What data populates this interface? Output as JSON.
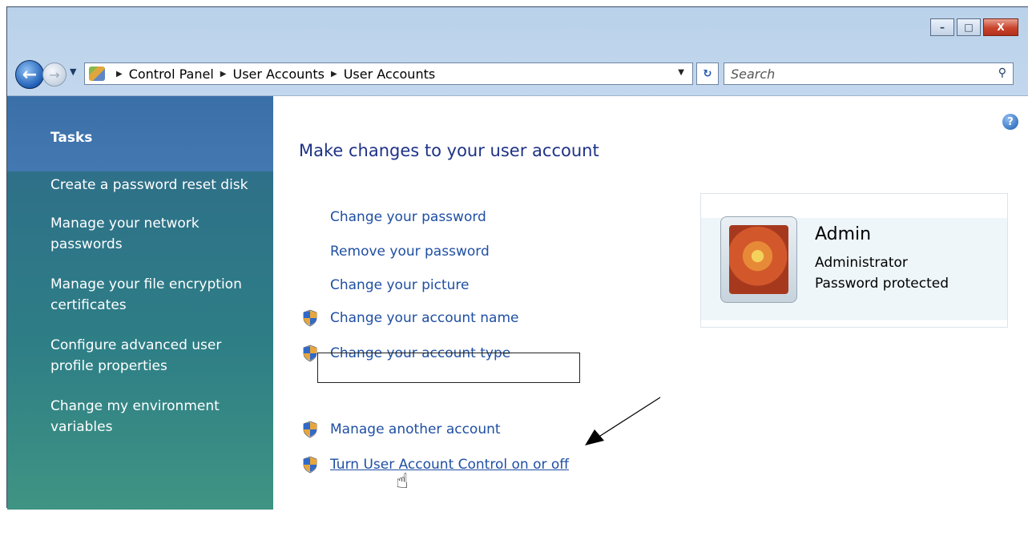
{
  "window": {
    "controls": {
      "minimize": "–",
      "maximize": "□",
      "close": "X"
    }
  },
  "nav": {
    "breadcrumb": [
      "Control Panel",
      "User Accounts",
      "User Accounts"
    ],
    "search_placeholder": "Search"
  },
  "sidebar": {
    "heading": "Tasks",
    "items": [
      {
        "label_lines": [
          "Create a password reset disk"
        ]
      },
      {
        "label_lines": [
          "Manage your network",
          "passwords"
        ]
      },
      {
        "label_lines": [
          "Manage your file encryption",
          "certificates"
        ]
      },
      {
        "label_lines": [
          "Configure advanced user",
          "profile properties"
        ]
      },
      {
        "label_lines": [
          "Change my environment",
          "variables"
        ]
      }
    ]
  },
  "main": {
    "title": "Make changes to your user account",
    "links": [
      {
        "label": "Change your password",
        "shield": false
      },
      {
        "label": "Remove your password",
        "shield": false
      },
      {
        "label": "Change your picture",
        "shield": false
      },
      {
        "label": "Change your account name",
        "shield": true
      },
      {
        "label": "Change your account type",
        "shield": true
      },
      {
        "label": "Manage another account",
        "shield": true
      },
      {
        "label": "Turn User Account Control on or off",
        "shield": true
      }
    ]
  },
  "account": {
    "name": "Admin",
    "role": "Administrator",
    "status": "Password protected"
  }
}
